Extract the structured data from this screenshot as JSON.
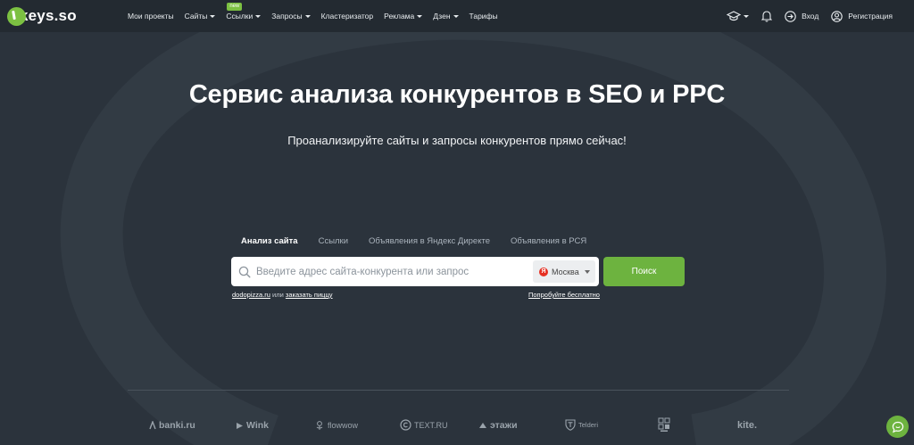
{
  "header": {
    "logo_text": "keys.so",
    "nav": [
      {
        "label": "Мои проекты",
        "caret": false
      },
      {
        "label": "Сайты",
        "caret": true
      },
      {
        "label": "Ссылки",
        "caret": true,
        "badge": "new"
      },
      {
        "label": "Запросы",
        "caret": true
      },
      {
        "label": "Кластеризатор",
        "caret": false
      },
      {
        "label": "Реклама",
        "caret": true
      },
      {
        "label": "Дзен",
        "caret": true
      },
      {
        "label": "Тарифы",
        "caret": false
      }
    ],
    "login_label": "Вход",
    "register_label": "Регистрация"
  },
  "hero": {
    "title": "Сервис анализа конкурентов в SEO и PPC",
    "subtitle": "Проанализируйте сайты и запросы конкурентов прямо сейчас!"
  },
  "search": {
    "tabs": [
      {
        "label": "Анализ сайта",
        "active": true
      },
      {
        "label": "Ссылки",
        "active": false
      },
      {
        "label": "Объявления в Яндекс Директе",
        "active": false
      },
      {
        "label": "Объявления в РСЯ",
        "active": false
      }
    ],
    "placeholder": "Введите адрес сайта-конкурента или запрос",
    "region_badge": "Я",
    "region": "Москва",
    "button_label": "Поиск",
    "hint_example_site": "dodopizza.ru",
    "hint_or": "или",
    "hint_example_query": "заказать пиццу",
    "try_free": "Попробуйте бесплатно"
  },
  "clients": [
    "banki.ru",
    "Wink",
    "flowwow",
    "TEXT.RU",
    "этажи",
    "Telderi",
    "kite."
  ],
  "colors": {
    "accent": "#6db33f",
    "background": "#2b333c",
    "header": "#232a31"
  }
}
